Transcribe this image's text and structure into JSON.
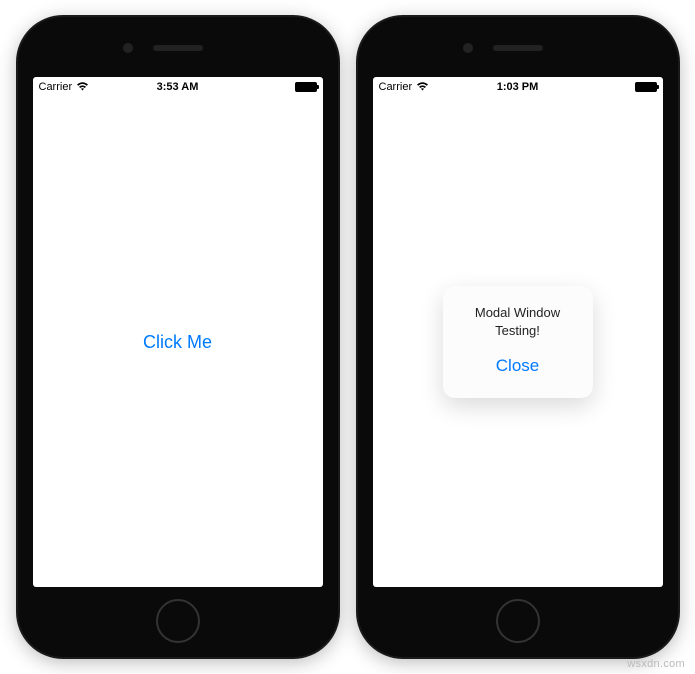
{
  "left_phone": {
    "status": {
      "carrier": "Carrier",
      "time": "3:53 AM"
    },
    "button_label": "Click Me"
  },
  "right_phone": {
    "status": {
      "carrier": "Carrier",
      "time": "1:03 PM"
    },
    "modal": {
      "message": "Modal Window Testing!",
      "close_label": "Close"
    }
  },
  "watermark": "wsxdn.com",
  "colors": {
    "ios_blue": "#007AFF"
  }
}
